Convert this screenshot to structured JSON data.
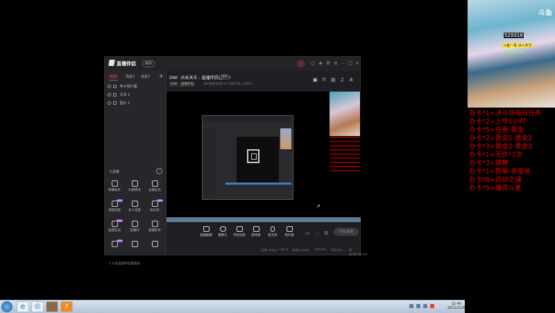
{
  "app": {
    "logo": "直播伴侣",
    "version_badge": "精简",
    "window_controls": [
      "feedback",
      "skin",
      "settings",
      "menu",
      "minimize",
      "maximize",
      "close"
    ],
    "sidebar": {
      "tabs": [
        {
          "label": "场景1",
          "active": true
        },
        {
          "label": "场景2"
        },
        {
          "label": "场景3"
        }
      ],
      "add_scene": "+",
      "sources": [
        {
          "label": "电子镜片图"
        },
        {
          "label": "文本 1"
        },
        {
          "label": "图片 1"
        }
      ],
      "toolbox_label": "工具箱",
      "tools": [
        {
          "label": "弹幕助手",
          "icon": "danmaku-icon"
        },
        {
          "label": "礼物特效",
          "icon": "gift-icon"
        },
        {
          "label": "主播任务",
          "icon": "task-icon"
        },
        {
          "label": "视频连麦",
          "icon": "video-call-icon",
          "badge": "NEW"
        },
        {
          "label": "多人连麦",
          "icon": "multi-call-icon"
        },
        {
          "label": "观众席",
          "icon": "audience-icon",
          "badge": "NEW"
        },
        {
          "label": "直播互动",
          "icon": "heart-icon",
          "badge": "NEW"
        },
        {
          "label": "直播间",
          "icon": "room-icon"
        },
        {
          "label": "直播助手",
          "icon": "assistant-icon"
        },
        {
          "label": "",
          "icon": "pk-icon",
          "badge": "NEW"
        },
        {
          "label": "",
          "icon": "rocket-icon"
        },
        {
          "label": "",
          "icon": "triangle-icon"
        }
      ],
      "hint": "1 头条直播伴侣最新版"
    },
    "header": {
      "title": "DNF -台长天王 - 直播伴侣通行中",
      "edit_button": "编辑",
      "tags": [
        "DNF",
        "直播伴侣"
      ],
      "room_info": "Dnf台长天王(小)  529318  ⌂ 2611"
    },
    "header_icons": [
      "share-screen-icon",
      "lock-icon",
      "bell-icon",
      "more-icon",
      "share-icon"
    ],
    "controls": [
      {
        "label": "直播截图",
        "icon": "screenshot-icon"
      },
      {
        "label": "摄像头",
        "icon": "camera-icon"
      },
      {
        "label": "手机投屏",
        "icon": "phone-cast-icon"
      },
      {
        "label": "游戏窗",
        "icon": "game-icon"
      },
      {
        "label": "麦克风",
        "icon": "mic-icon"
      },
      {
        "label": "扬声器",
        "icon": "speaker-icon"
      }
    ],
    "start_button": "开始直播",
    "stats": [
      "码率:0kbps",
      "FPS:0",
      "丢帧:0.00%",
      "CPU:0%",
      "内存:0%",
      "时长:00:00:00"
    ]
  },
  "overlay": {
    "platform_mark": "斗鱼",
    "room_number": "529318",
    "yellow_label": "斗鱼一哥 决斗天王",
    "green_label": "全场满级 MAX",
    "tasks": [
      "办卡*1=决斗场每日任务",
      "办卡*2=上号1小时",
      "办卡*5=任意-黄金",
      "办卡*2=黄金1-黄金2",
      "办卡*3=黄金2-黄金3",
      "办卡*1=无伤*2次",
      "办卡*3=跳舞",
      "办卡*1=歌单-帝皇侠",
      "办卡*8=武动之魂",
      "办卡*5=魔灵斗者"
    ]
  },
  "taskbar": {
    "apps": [
      "ie-icon",
      "browser-icon",
      "game-icon",
      "streamer-icon"
    ],
    "clock_time": "12:40",
    "clock_date": "2021/11/5"
  }
}
